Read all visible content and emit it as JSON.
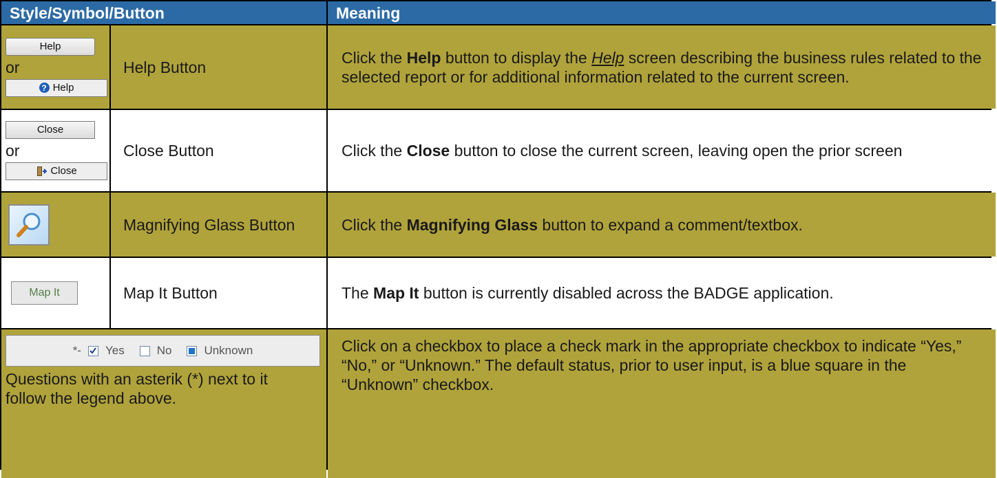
{
  "header": {
    "col1": "Style/Symbol/Button",
    "col2": "Meaning"
  },
  "rows": [
    {
      "button_a": "Help",
      "or": "or",
      "button_b": "Help",
      "name": "Help Button",
      "meaning_1": "Click the ",
      "meaning_bold": "Help",
      "meaning_2": " button to display the ",
      "meaning_link": "Help",
      "meaning_3": " screen describing the business rules related to the selected report or for additional information related to the current screen."
    },
    {
      "button_a": "Close",
      "or": "or",
      "button_b": "Close",
      "name": "Close Button",
      "meaning_1": "Click the ",
      "meaning_bold": "Close",
      "meaning_2": " button to close the current screen, leaving open the prior screen"
    },
    {
      "name": "Magnifying Glass Button",
      "meaning_1": "Click the ",
      "meaning_bold": "Magnifying Glass",
      "meaning_2": " button to expand a comment/textbox."
    },
    {
      "button": "Map It",
      "name": "Map It Button",
      "meaning_1": "The ",
      "meaning_bold": "Map It",
      "meaning_2": " button is currently disabled across the BADGE application."
    },
    {
      "legend": {
        "asterisk": "*-",
        "yes": "Yes",
        "no": "No",
        "unknown": "Unknown"
      },
      "note": "Questions with an asterik (*) next to it follow the legend above.",
      "meaning": "Click on a checkbox to place a check mark in the appropriate checkbox to indicate “Yes,” “No,” or “Unknown.”  The default status, prior to user input, is a blue square in the “Unknown” checkbox."
    }
  ],
  "colors": {
    "header": "#2c6aa5",
    "olive": "#b0a33b"
  }
}
